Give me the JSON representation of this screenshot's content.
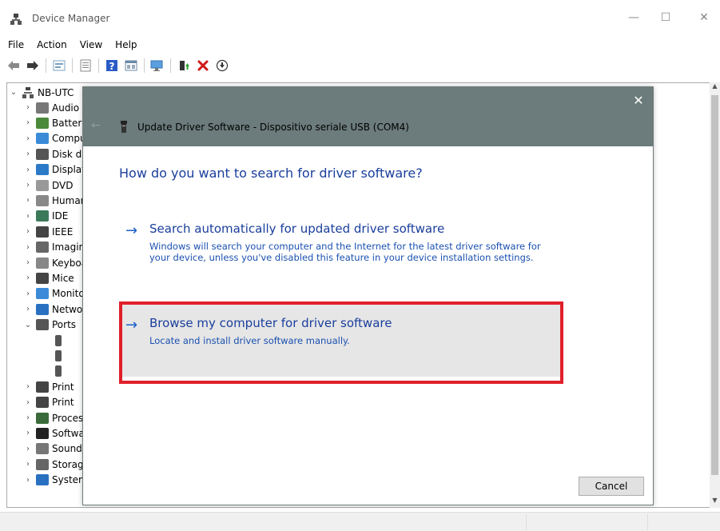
{
  "window": {
    "title": "Device Manager",
    "minimize_glyph": "—",
    "maximize_glyph": "☐",
    "close_glyph": "✕"
  },
  "menu": [
    "File",
    "Action",
    "View",
    "Help"
  ],
  "toolbar": {
    "icons": [
      "back-icon",
      "forward-icon",
      "properties-icon",
      "show-hidden-icon",
      "help-icon",
      "resources-icon",
      "scan-hardware-icon",
      "update-driver-icon",
      "uninstall-icon",
      "download-icon"
    ]
  },
  "tree": {
    "root": "NB-UTC",
    "items": [
      {
        "label": "Audio",
        "icon": "audio-icon",
        "expanded": false
      },
      {
        "label": "Batteries",
        "icon": "battery-icon",
        "expanded": false
      },
      {
        "label": "Computer",
        "icon": "computer-icon",
        "expanded": false
      },
      {
        "label": "Disk drives",
        "icon": "disk-icon",
        "expanded": false
      },
      {
        "label": "Display adapters",
        "icon": "display-icon",
        "expanded": false
      },
      {
        "label": "DVD",
        "icon": "dvd-icon",
        "expanded": false
      },
      {
        "label": "Human",
        "icon": "hid-icon",
        "expanded": false
      },
      {
        "label": "IDE",
        "icon": "ide-icon",
        "expanded": false
      },
      {
        "label": "IEEE",
        "icon": "ieee-icon",
        "expanded": false
      },
      {
        "label": "Imaging",
        "icon": "imaging-icon",
        "expanded": false
      },
      {
        "label": "Keyboards",
        "icon": "keyboard-icon",
        "expanded": false
      },
      {
        "label": "Mice",
        "icon": "mouse-icon",
        "expanded": false
      },
      {
        "label": "Monitors",
        "icon": "monitor-icon",
        "expanded": false
      },
      {
        "label": "Network",
        "icon": "network-icon",
        "expanded": false
      },
      {
        "label": "Ports",
        "icon": "port-icon",
        "expanded": true
      },
      {
        "label": "",
        "icon": "port-device-icon",
        "child": true
      },
      {
        "label": "",
        "icon": "port-device-icon",
        "child": true
      },
      {
        "label": "",
        "icon": "port-device-icon",
        "child": true
      },
      {
        "label": "Print",
        "icon": "printer-icon",
        "expanded": false
      },
      {
        "label": "Print",
        "icon": "printer-icon",
        "expanded": false
      },
      {
        "label": "Processors",
        "icon": "processor-icon",
        "expanded": false
      },
      {
        "label": "Software",
        "icon": "software-icon",
        "expanded": false
      },
      {
        "label": "Sound",
        "icon": "sound-icon",
        "expanded": false
      },
      {
        "label": "Storage",
        "icon": "storage-icon",
        "expanded": false
      },
      {
        "label": "System devices",
        "icon": "system-icon",
        "expanded": false
      }
    ]
  },
  "dialog": {
    "title": "Update Driver Software - Dispositivo seriale USB (COM4)",
    "close_glyph": "✕",
    "back_glyph": "←",
    "question": "How do you want to search for driver software?",
    "options": [
      {
        "title": "Search automatically for updated driver software",
        "description": "Windows will search your computer and the Internet for the latest driver software for your device, unless you've disabled this feature in your device installation settings."
      },
      {
        "title": "Browse my computer for driver software",
        "description": "Locate and install driver software manually."
      }
    ],
    "arrow_glyph": "→",
    "cancel_label": "Cancel"
  },
  "colors": {
    "dialog_header": "#6c7b7b",
    "link_blue": "#1a3e9c",
    "highlight_red": "#e0202a"
  }
}
